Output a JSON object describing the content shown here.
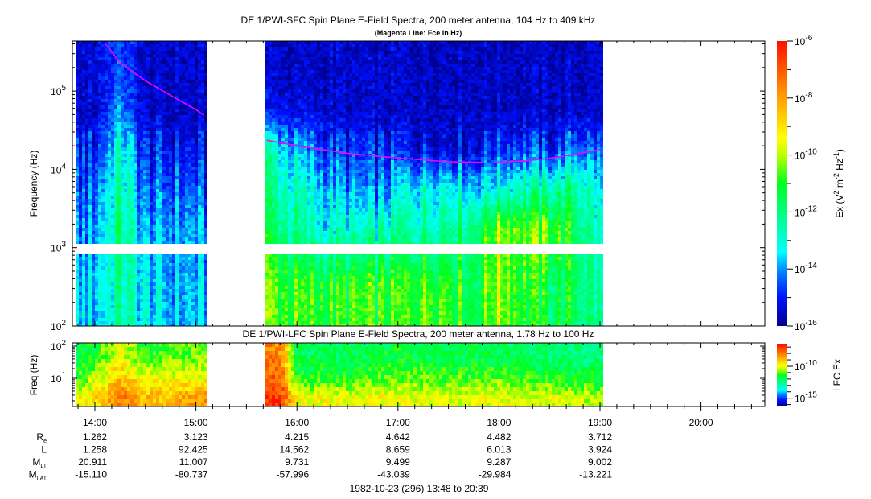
{
  "chart_data": [
    {
      "type": "heatmap",
      "title": "DE 1/PWI-SFC  Spin Plane E-Field Spectra, 200 meter antenna, 104 Hz to 409 kHz",
      "subtitle": "(Magenta Line: Fce in Hz)",
      "ylabel": "Frequency (Hz)",
      "yscale": "log",
      "ylim": [
        100,
        409000
      ],
      "yticks": [
        {
          "base": "10",
          "exp": "5",
          "value": 100000
        },
        {
          "base": "10",
          "exp": "4",
          "value": 10000
        },
        {
          "base": "10",
          "exp": "3",
          "value": 1000
        },
        {
          "base": "10",
          "exp": "2",
          "value": 100
        }
      ],
      "colorbar": {
        "label": "Ex (V",
        "label_sup1": "2",
        "label_mid": " m",
        "label_sup2": "-2",
        "label_mid2": " Hz",
        "label_sup3": "-1",
        "label_end": ")",
        "range_log10": [
          -16,
          -6
        ],
        "ticks": [
          {
            "base": "10",
            "exp": "-6",
            "value": -6
          },
          {
            "base": "10",
            "exp": "-8",
            "value": -8
          },
          {
            "base": "10",
            "exp": "-10",
            "value": -10
          },
          {
            "base": "10",
            "exp": "-12",
            "value": -12
          },
          {
            "base": "10",
            "exp": "-14",
            "value": -14
          },
          {
            "base": "10",
            "exp": "-16",
            "value": -16
          }
        ]
      },
      "data_gaps_hours": [
        [
          15.12,
          15.7
        ],
        [
          19.04,
          20.65
        ]
      ],
      "gap_frequency_hz": 1000,
      "freq_band_edges_log10": [
        2,
        3,
        3.48,
        4,
        4.48,
        5,
        5.61
      ],
      "times_hours": [
        13.8,
        14.0,
        14.25,
        14.5,
        14.75,
        15.0,
        15.12,
        15.7,
        16.0,
        16.25,
        16.5,
        16.75,
        17.0,
        17.25,
        17.5,
        17.75,
        18.0,
        18.25,
        18.5,
        18.75,
        19.0,
        19.04
      ],
      "values_log10": [
        [
          -13.8,
          -14.5,
          -14.8,
          -15.0,
          -15.5,
          -15.5
        ],
        [
          -13.5,
          -13.8,
          -14.3,
          -14.8,
          -15.5,
          -15.3
        ],
        [
          -12.5,
          -12.0,
          -12.5,
          -13.0,
          -14.0,
          -14.5
        ],
        [
          -13.5,
          -14.0,
          -14.5,
          -15.0,
          -15.5,
          -15.5
        ],
        [
          -13.8,
          -14.0,
          -14.5,
          -15.0,
          -15.5,
          -15.5
        ],
        [
          -13.8,
          -14.0,
          -14.5,
          -15.2,
          -15.5,
          -15.5
        ],
        [
          -13.8,
          -14.2,
          -14.8,
          -15.3,
          -15.5,
          -15.5
        ],
        [
          -10.5,
          -11.5,
          -12.0,
          -12.5,
          -15.0,
          -15.5
        ],
        [
          -11.0,
          -12.5,
          -13.0,
          -14.0,
          -15.3,
          -15.5
        ],
        [
          -11.0,
          -13.0,
          -13.5,
          -14.5,
          -15.3,
          -15.5
        ],
        [
          -11.0,
          -13.0,
          -14.0,
          -15.0,
          -15.5,
          -15.5
        ],
        [
          -11.0,
          -13.0,
          -14.5,
          -15.0,
          -15.5,
          -15.5
        ],
        [
          -11.0,
          -12.5,
          -13.5,
          -15.0,
          -15.5,
          -15.5
        ],
        [
          -10.5,
          -12.5,
          -13.0,
          -15.0,
          -15.5,
          -15.5
        ],
        [
          -10.5,
          -12.0,
          -13.0,
          -15.0,
          -15.5,
          -15.5
        ],
        [
          -11.5,
          -12.0,
          -13.5,
          -15.2,
          -15.5,
          -15.5
        ],
        [
          -10.0,
          -10.0,
          -13.0,
          -14.5,
          -15.5,
          -15.5
        ],
        [
          -11.0,
          -10.5,
          -12.5,
          -14.5,
          -15.5,
          -15.5
        ],
        [
          -11.5,
          -10.5,
          -12.5,
          -15.0,
          -15.5,
          -15.5
        ],
        [
          -11.5,
          -11.5,
          -12.0,
          -14.0,
          -15.5,
          -15.5
        ],
        [
          -12.5,
          -13.0,
          -13.5,
          -14.5,
          -15.5,
          -15.5
        ],
        [
          -12.5,
          -13.0,
          -13.5,
          -14.5,
          -15.5,
          -15.5
        ]
      ],
      "fce_line": {
        "name": "Fce",
        "color": "#ff00ff",
        "segments": [
          [
            [
              14.1,
              409000
            ],
            [
              14.25,
              230000
            ],
            [
              14.5,
              135000
            ],
            [
              14.75,
              88000
            ],
            [
              15.0,
              58000
            ],
            [
              15.08,
              49000
            ]
          ],
          [
            [
              15.7,
              23500
            ],
            [
              16.0,
              20000
            ],
            [
              16.5,
              16000
            ],
            [
              17.0,
              14000
            ],
            [
              17.5,
              12500
            ],
            [
              17.85,
              12300
            ]
          ],
          [
            [
              17.95,
              12300
            ],
            [
              18.25,
              12800
            ],
            [
              18.5,
              13800
            ],
            [
              18.75,
              15500
            ],
            [
              19.0,
              18000
            ]
          ]
        ]
      }
    },
    {
      "type": "heatmap",
      "title": "DE 1/PWI-LFC  Spin Plane E-Field Spectra, 200 meter antenna, 1.78 Hz to 100 Hz",
      "ylabel": "Freq (Hz)",
      "yscale": "log",
      "ylim": [
        1.78,
        100
      ],
      "yticks": [
        {
          "base": "10",
          "exp": "2",
          "value": 100
        },
        {
          "base": "10",
          "exp": "1",
          "value": 10
        }
      ],
      "colorbar": {
        "label": "LFC Ex",
        "range_log10": [
          -16.3,
          -6.6
        ],
        "ticks": [
          {
            "base": "10",
            "exp": "-10",
            "value": -10
          },
          {
            "base": "10",
            "exp": "-15",
            "value": -15
          }
        ]
      },
      "freq_band_edges_log10": [
        0.12,
        0.7,
        1.3,
        2.05
      ],
      "times_hours": [
        13.8,
        14.0,
        14.25,
        14.5,
        14.75,
        15.0,
        15.12,
        15.7,
        15.85,
        16.0,
        16.5,
        17.0,
        17.5,
        18.0,
        18.5,
        19.0,
        19.04
      ],
      "values_log10": [
        [
          -10.0,
          -11.5,
          -12.0
        ],
        [
          -9.5,
          -10.5,
          -11.5
        ],
        [
          -8.0,
          -9.0,
          -10.0
        ],
        [
          -9.0,
          -10.0,
          -11.5
        ],
        [
          -9.0,
          -10.0,
          -11.0
        ],
        [
          -8.5,
          -10.0,
          -11.0
        ],
        [
          -8.5,
          -10.0,
          -11.0
        ],
        [
          -7.0,
          -7.5,
          -8.0
        ],
        [
          -7.2,
          -7.8,
          -8.5
        ],
        [
          -10.0,
          -11.5,
          -12.0
        ],
        [
          -10.0,
          -11.5,
          -12.0
        ],
        [
          -10.0,
          -11.0,
          -11.8
        ],
        [
          -10.2,
          -11.2,
          -12.0
        ],
        [
          -10.0,
          -11.0,
          -12.0
        ],
        [
          -10.2,
          -11.5,
          -12.2
        ],
        [
          -10.5,
          -11.8,
          -12.5
        ],
        [
          -10.5,
          -11.8,
          -12.5
        ]
      ]
    }
  ],
  "time_axis": {
    "ticks": [
      {
        "label": "14:00",
        "hour": 14
      },
      {
        "label": "15:00",
        "hour": 15
      },
      {
        "label": "16:00",
        "hour": 16
      },
      {
        "label": "17:00",
        "hour": 17
      },
      {
        "label": "18:00",
        "hour": 18
      },
      {
        "label": "19:00",
        "hour": 19
      },
      {
        "label": "20:00",
        "hour": 20
      }
    ],
    "range_hours": [
      13.8,
      20.65
    ],
    "caption": "1982-10-23 (296) 13:48 to 20:39"
  },
  "ephemeris": [
    {
      "label": "R",
      "sub": "e",
      "values": [
        "1.262",
        "3.123",
        "4.215",
        "4.642",
        "4.482",
        "3.712"
      ]
    },
    {
      "label": "L",
      "sub": "",
      "values": [
        "1.258",
        "92.425",
        "14.562",
        "8.659",
        "6.013",
        "3.924"
      ]
    },
    {
      "label": "M",
      "sub": "LT",
      "values": [
        "20.911",
        "11.007",
        "9.731",
        "9.499",
        "9.287",
        "9.002"
      ]
    },
    {
      "label": "M",
      "sub": "LAT",
      "values": [
        "-15.110",
        "-80.737",
        "-57.996",
        "-43.039",
        "-29.984",
        "-13.221"
      ]
    }
  ]
}
